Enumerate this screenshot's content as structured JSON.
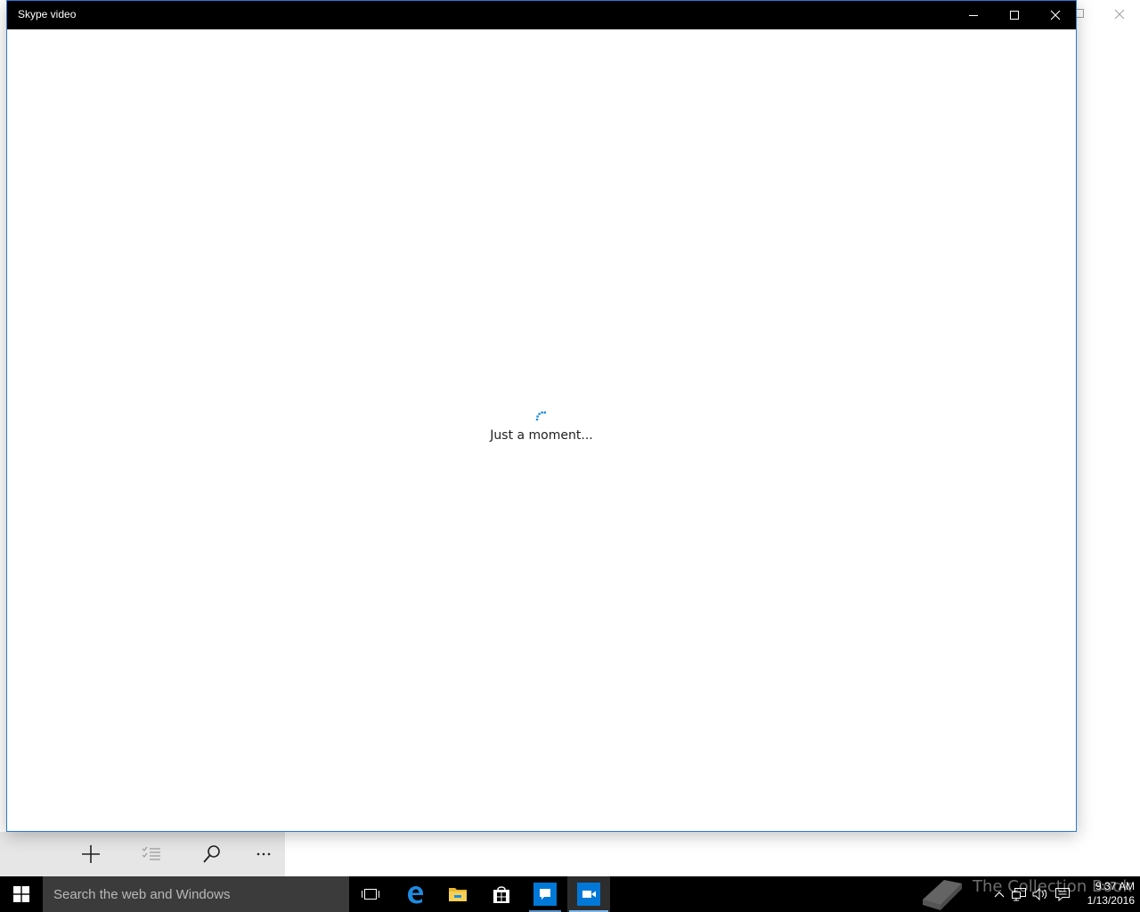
{
  "window": {
    "title": "Skype video"
  },
  "content": {
    "loading_text": "Just a moment..."
  },
  "taskbar": {
    "search_placeholder": "Search the web and Windows",
    "pinned": [
      "task-view",
      "edge",
      "file-explorer",
      "store",
      "skype-messaging",
      "skype-video"
    ],
    "active": "skype-video",
    "clock_time": "9:37 AM",
    "clock_date": "1/13/2016"
  },
  "watermark": {
    "text": "The Collection Book"
  },
  "colors": {
    "titlebar": "#000000",
    "window_border": "#2b79d6",
    "spinner": "#1e8be0",
    "taskbar": "#000000",
    "search_box": "#3b3b3b",
    "active_underline": "#7ab4ea",
    "skype_blue": "#0078d7"
  }
}
